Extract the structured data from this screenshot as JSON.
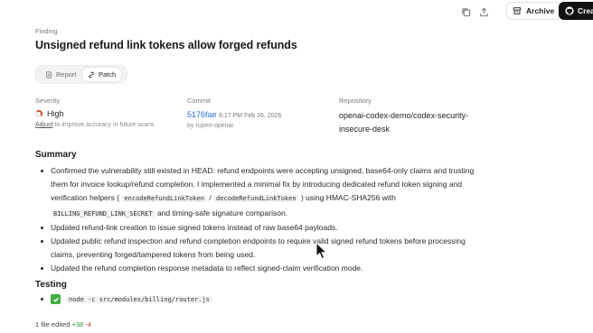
{
  "header": {
    "archive_label": "Archive",
    "create_label": "Crea"
  },
  "finding": {
    "label": "Finding",
    "title": "Unsigned refund link tokens allow forged refunds"
  },
  "tabs": [
    {
      "label": "Report",
      "icon": "document-icon",
      "active": false
    },
    {
      "label": "Patch",
      "icon": "link-icon",
      "active": true
    }
  ],
  "meta": {
    "severity_label": "Severity",
    "severity_value": "High",
    "severity_adjust_link": "Adjust",
    "severity_adjust_text": "to improve accuracy in future scans",
    "commit_label": "Commit",
    "commit_hash": "5176fae",
    "commit_date": "6:17 PM Feb 26, 2026",
    "commit_by": "by rupert-openai",
    "repository_label": "Repository",
    "repository_value": "openai-codex-demo/codex-security-insecure-desk"
  },
  "summary": {
    "heading": "Summary",
    "items": [
      {
        "t1": "Confirmed the vulnerability still existed in HEAD: refund endpoints were accepting unsigned, base64-only claims and trusting them for invoice lookup/refund completion. I implemented a minimal fix by introducing dedicated refund token signing and verification helpers (",
        "c1": "encodeRefundLinkToken",
        "t2": " / ",
        "c2": "decodeRefundLinkToken",
        "t3": ") using HMAC-SHA256 with ",
        "c3": "BILLING_REFUND_LINK_SECRET",
        "t4": " and timing-safe signature comparison."
      },
      {
        "text": "Updated refund-link creation to issue signed tokens instead of raw base64 payloads."
      },
      {
        "text": "Updated public refund inspection and refund completion endpoints to require valid signed refund tokens before processing claims, preventing forged/tampered tokens from being used."
      },
      {
        "text": "Updated the refund completion response metadata to reflect signed-claim verification mode."
      }
    ]
  },
  "testing": {
    "heading": "Testing",
    "command": "node -c src/modules/billing/router.js",
    "status_icon": "check-icon"
  },
  "footer": {
    "files_edited": "1 file edited",
    "additions": "+38",
    "deletions": "-4"
  },
  "colors": {
    "accent_link": "#2f6fce",
    "severity_high": "#d44a2c",
    "success": "#3fae3f",
    "additions": "#2e9a45",
    "deletions": "#d0453a"
  }
}
